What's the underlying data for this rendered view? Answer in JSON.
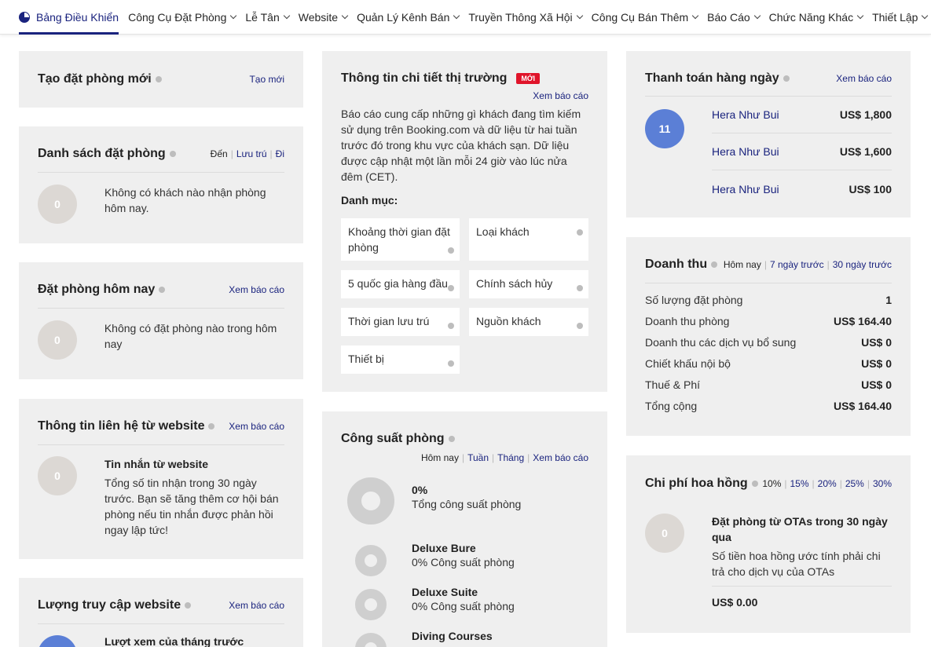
{
  "nav": {
    "items": [
      {
        "label": "Bảng Điều Khiển"
      },
      {
        "label": "Công Cụ Đặt Phòng"
      },
      {
        "label": "Lễ Tân"
      },
      {
        "label": "Website"
      },
      {
        "label": "Quản Lý Kênh Bán"
      },
      {
        "label": "Truyền Thông Xã Hội"
      },
      {
        "label": "Công Cụ Bán Thêm"
      },
      {
        "label": "Báo Cáo"
      },
      {
        "label": "Chức Năng Khác"
      },
      {
        "label": "Thiết Lập"
      }
    ]
  },
  "create_booking": {
    "title": "Tạo đặt phòng mới",
    "link": "Tạo mới"
  },
  "booking_list": {
    "title": "Danh sách đặt phòng",
    "filters": [
      "Đến",
      "Lưu trú",
      "Đi"
    ],
    "count": "0",
    "message": "Không có khách nào nhận phòng hôm nay."
  },
  "today_bookings": {
    "title": "Đặt phòng hôm nay",
    "link": "Xem báo cáo",
    "count": "0",
    "message": "Không có đặt phòng nào trong hôm nay"
  },
  "website_contact": {
    "title": "Thông tin liên hệ từ website",
    "link": "Xem báo cáo",
    "count": "0",
    "subtitle": "Tin nhắn từ website",
    "message": "Tổng số tin nhận trong 30 ngày trước. Bạn sẽ tăng thêm cơ hội bán phòng nếu tin nhắn được phản hồi ngay lập tức!"
  },
  "website_traffic": {
    "title": "Lượng truy cập website",
    "link": "Xem báo cáo",
    "subtitle": "Lượt xem của tháng trước"
  },
  "market_insight": {
    "title": "Thông tin chi tiết thị trường",
    "badge": "MỚI",
    "link": "Xem báo cáo",
    "description": "Báo cáo cung cấp những gì khách đang tìm kiếm sử dụng trên Booking.com và dữ liệu từ hai tuần trước đó trong khu vực của khách sạn. Dữ liệu được cập nhật một lần mỗi 24 giờ vào lúc nửa đêm (CET).",
    "category_label": "Danh mục:",
    "categories": [
      "Khoảng thời gian đặt phòng",
      "Loại khách",
      "5 quốc gia hàng đầu",
      "Chính sách hủy",
      "Thời gian lưu trú",
      "Nguồn khách",
      "Thiết bị"
    ]
  },
  "occupancy": {
    "title": "Công suất phòng",
    "filters": [
      "Hôm nay",
      "Tuần",
      "Tháng",
      "Xem báo cáo"
    ],
    "total_pct": "0%",
    "total_label": "Tổng công suất phòng",
    "rooms": [
      {
        "name": "Deluxe Bure",
        "value": "0% Công suất phòng"
      },
      {
        "name": "Deluxe Suite",
        "value": "0% Công suất phòng"
      },
      {
        "name": "Diving Courses",
        "value": ""
      }
    ]
  },
  "daily_payment": {
    "title": "Thanh toán hàng ngày",
    "link": "Xem báo cáo",
    "count": "11",
    "rows": [
      {
        "name": "Hera Như Bui",
        "amount": "US$ 1,800"
      },
      {
        "name": "Hera Như Bui",
        "amount": "US$ 1,600"
      },
      {
        "name": "Hera Như Bui",
        "amount": "US$ 100"
      }
    ]
  },
  "revenue": {
    "title": "Doanh thu",
    "filters": [
      "Hôm nay",
      "7 ngày trước",
      "30 ngày trước"
    ],
    "rows": [
      {
        "label": "Số lượng đặt phòng",
        "value": "1"
      },
      {
        "label": "Doanh thu phòng",
        "value": "US$ 164.40"
      },
      {
        "label": "Doanh thu các dịch vụ bổ sung",
        "value": "US$ 0"
      },
      {
        "label": "Chiết khấu nội bộ",
        "value": "US$ 0"
      },
      {
        "label": "Thuế & Phí",
        "value": "US$ 0"
      },
      {
        "label": "Tổng cộng",
        "value": "US$ 164.40"
      }
    ]
  },
  "commission": {
    "title": "Chi phí hoa hồng",
    "rates": [
      "10%",
      "15%",
      "20%",
      "25%",
      "30%"
    ],
    "count": "0",
    "subtitle": "Đặt phòng từ OTAs trong 30 ngày qua",
    "message": "Số tiền hoa hồng ước tính phải chi trả cho dịch vụ của OTAs",
    "amount": "US$ 0.00"
  },
  "colors": {
    "accent": "#1a237e",
    "badge": "#e0142a",
    "card_bg": "#efefef",
    "payment_circle": "#5b7fd6"
  }
}
